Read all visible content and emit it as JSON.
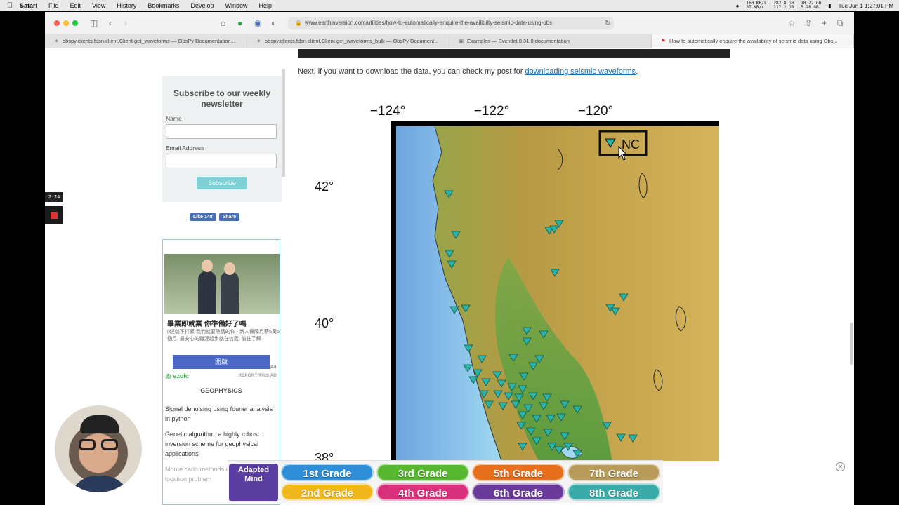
{
  "menubar": {
    "app": "Safari",
    "items": [
      "File",
      "Edit",
      "View",
      "History",
      "Bookmarks",
      "Develop",
      "Window",
      "Help"
    ],
    "net_up": "160 KB/s",
    "net_down": "37 KB/s",
    "disk1": "282.8 GB",
    "disk2": "217.2 GB",
    "mem1": "10.72 GB",
    "mem2": "5.28 GB",
    "datetime": "Tue Jun 1  1:27:01 PM"
  },
  "browser": {
    "url": "www.earthinversion.com/utilities/how-to-automatically-enquire-the-availibilty-seismic-data-using-obs",
    "tabs": [
      {
        "label": "obspy.clients.fdsn.client.Client.get_waveforms — ObsPy Documentation...",
        "icon": "obspy-icon"
      },
      {
        "label": "obspy.clients.fdsn.client.Client.get_waveforms_bulk — ObsPy Document...",
        "icon": "obspy-icon"
      },
      {
        "label": "Examples — Eventlet 0.31.0 documentation",
        "icon": "eventlet-icon"
      },
      {
        "label": "How to automatically enquire the availability of seismic data using Obs...",
        "icon": "earthinversion-icon"
      }
    ]
  },
  "article": {
    "intro_text": "Next, if you want to download the data, you can check my post for ",
    "intro_link": "downloading seismic waveforms",
    "intro_end": "."
  },
  "newsletter": {
    "title": "Subscribe to our weekly newsletter",
    "name_label": "Name",
    "email_label": "Email Address",
    "subscribe_label": "Subscribe"
  },
  "social": {
    "like_label": "Like 148",
    "share_label": "Share"
  },
  "sidebar_ad": {
    "title": "畢業即就業 你準備好了嗎",
    "desc": "0經驗不打緊 我們就要熱情的你 - 新人保障月薪5萬6個月, 最安心的職涯起步就在信義. 前往了解",
    "button": "開啟",
    "ad_mark": "Ad",
    "ezoic": "ezoic",
    "report": "REPORT THIS AD"
  },
  "geophysics": {
    "heading": "GEOPHYSICS",
    "links": [
      "Signal denoising using fourier analysis in python",
      "Genetic algorithm: a highly robust inversion scheme for geophysical applications",
      "Monte carlo methods and earthquake location problem"
    ]
  },
  "recorder": {
    "time": "2:24"
  },
  "map": {
    "lon_labels": [
      "−124°",
      "−122°",
      "−120°"
    ],
    "lat_labels": [
      "42°",
      "40°",
      "38°"
    ],
    "legend": "NC",
    "station_color": "#2ab3a6"
  },
  "bottom_ad": {
    "logo": "Adapted Mind",
    "grades": [
      {
        "label": "1st Grade",
        "color": "#2f8fd8"
      },
      {
        "label": "3rd Grade",
        "color": "#58b830"
      },
      {
        "label": "5th Grade",
        "color": "#e8701c"
      },
      {
        "label": "7th Grade",
        "color": "#b89a5a"
      },
      {
        "label": "2nd Grade",
        "color": "#f0b81c"
      },
      {
        "label": "4th Grade",
        "color": "#d8307a"
      },
      {
        "label": "6th Grade",
        "color": "#6a3a9a"
      },
      {
        "label": "8th Grade",
        "color": "#3aaaa8"
      }
    ]
  }
}
